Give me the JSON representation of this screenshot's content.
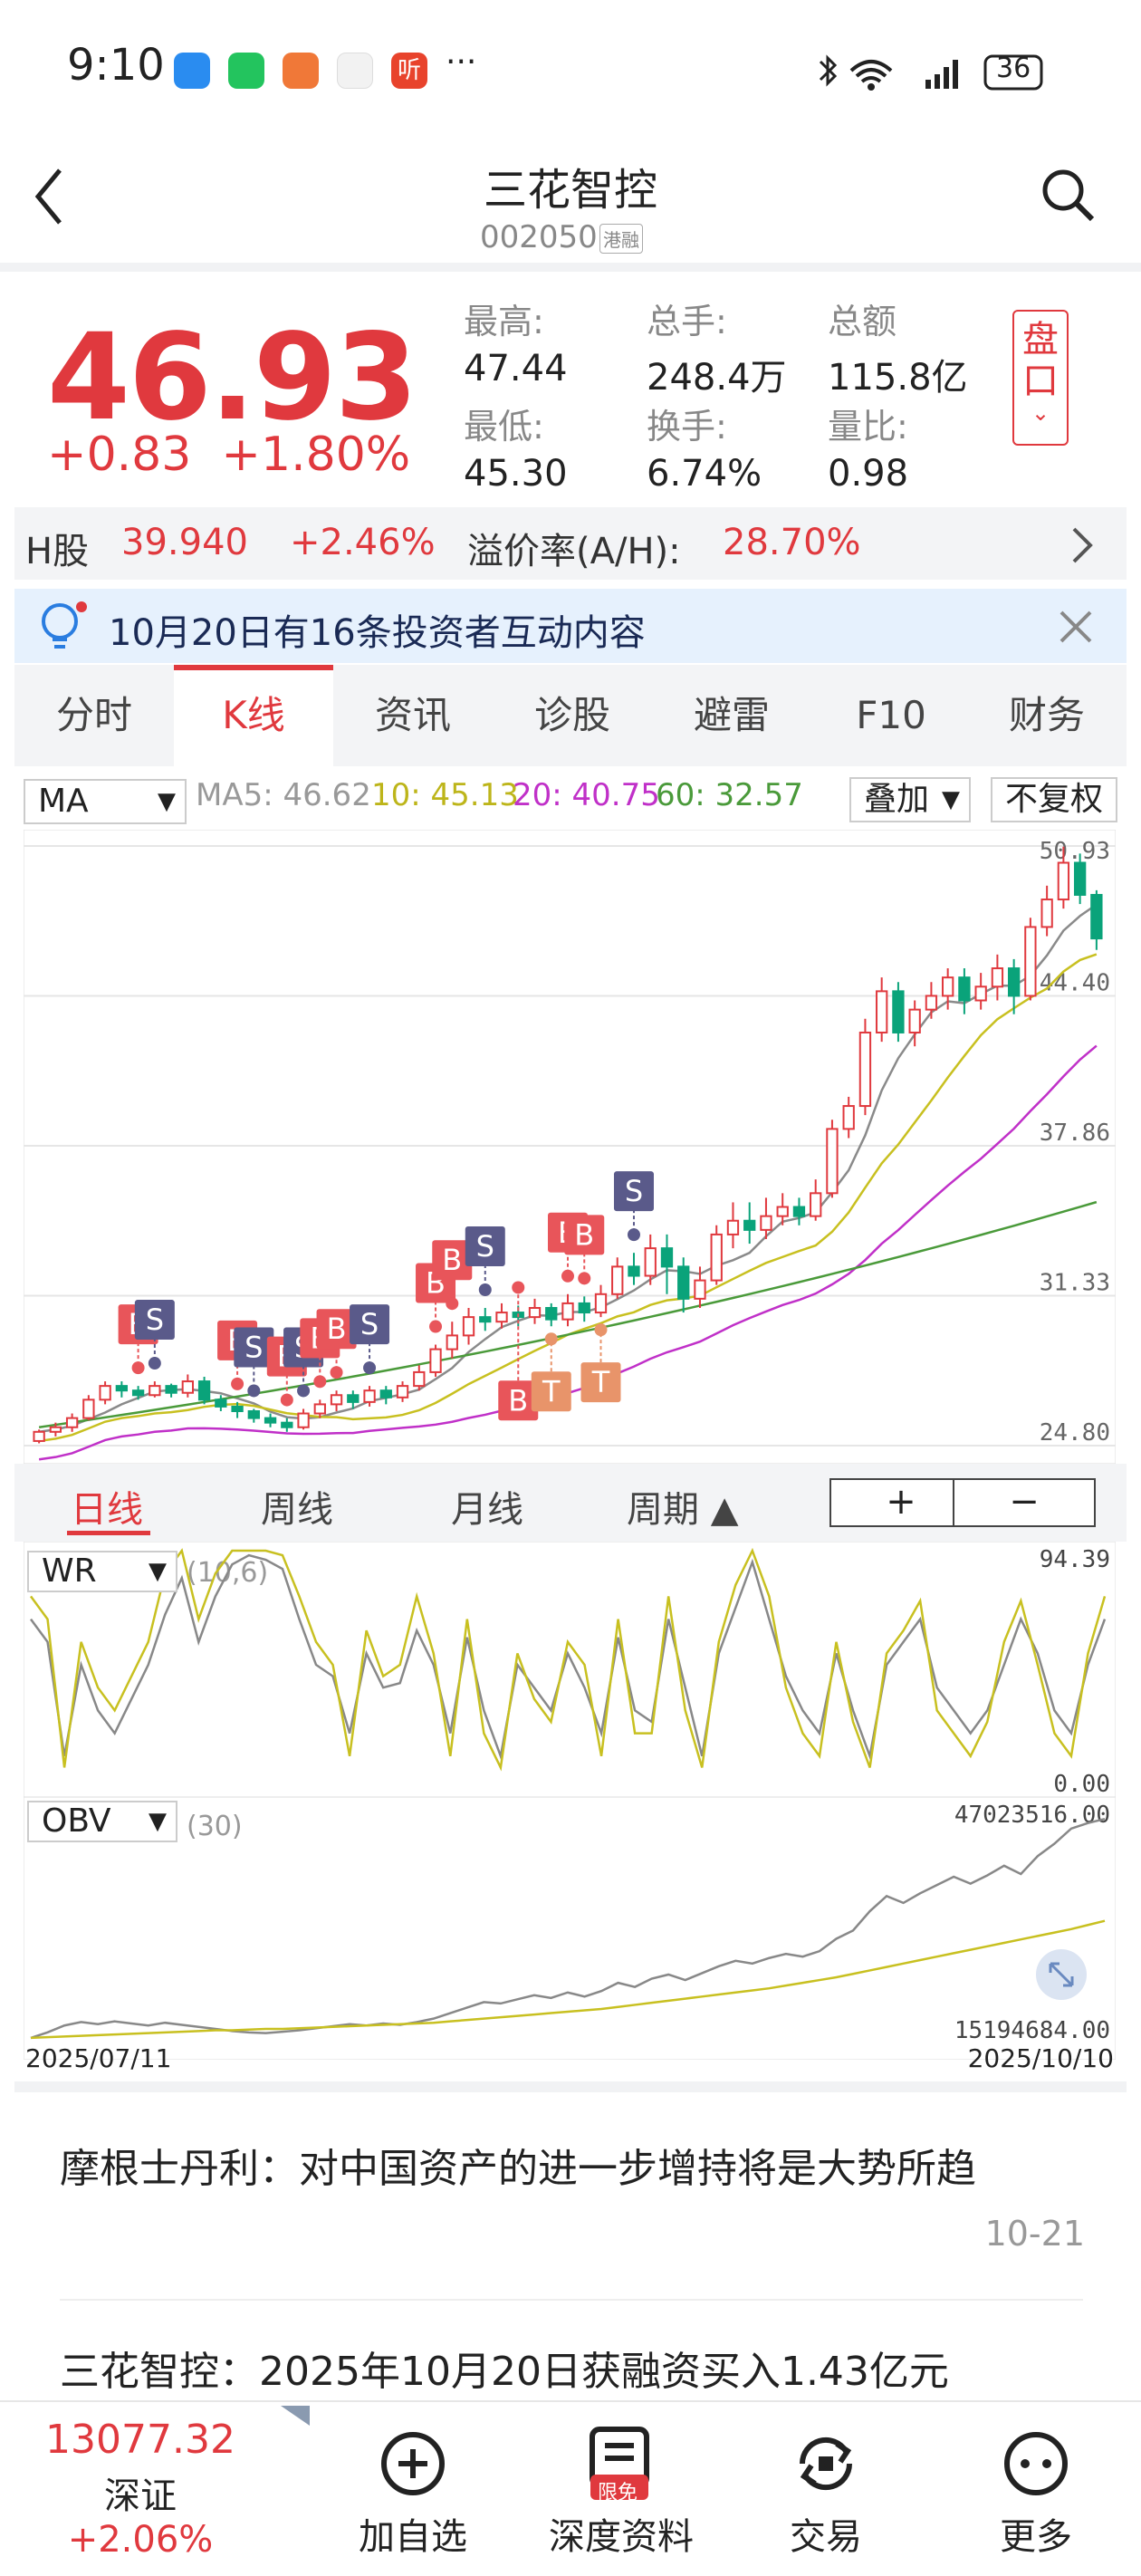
{
  "status_bar": {
    "time": "9:10",
    "more": "···",
    "battery": "36"
  },
  "header": {
    "title": "三花智控",
    "code": "002050",
    "badge": "港融"
  },
  "quote": {
    "price": "46.93",
    "change": "+0.83",
    "change_pct": "+1.80%",
    "high_label": "最高:",
    "high": "47.44",
    "low_label": "最低:",
    "low": "45.30",
    "volume_label": "总手:",
    "volume": "248.4万",
    "turnover_label": "换手:",
    "turnover": "6.74%",
    "amount_label": "总额",
    "amount": "115.8亿",
    "ratio_label": "量比:",
    "ratio": "0.98",
    "pankou": [
      "盘",
      "口"
    ]
  },
  "hshare": {
    "label": "H股",
    "price": "39.940",
    "pct": "+2.46%",
    "premium_label": "溢价率(A/H):",
    "premium": "28.70%"
  },
  "notice": {
    "text": "10月20日有16条投资者互动内容"
  },
  "tabs": [
    "分时",
    "K线",
    "资讯",
    "诊股",
    "避雷",
    "F10",
    "财务"
  ],
  "ma_row": {
    "selector": "MA",
    "ma5": "MA5: 46.62",
    "ma10": "10: 45.13",
    "ma20": "20: 40.75",
    "ma60": "60: 32.57",
    "overlay": "叠加",
    "adjust": "不复权"
  },
  "colors": {
    "up": "#e0393e",
    "down": "#0aa37a",
    "ma5": "#8a8a8a",
    "ma10": "#c8c020",
    "ma20": "#c030c8",
    "ma60": "#4a9a3a",
    "buy": "#e8555a",
    "sell": "#5a5a8a",
    "t": "#e8946a"
  },
  "chart_data": [
    {
      "type": "candlestick",
      "y_ticks": [
        "50.93",
        "44.40",
        "37.86",
        "31.33",
        "24.80"
      ],
      "ylim": [
        24.8,
        50.93
      ],
      "candles": [
        [
          25.0,
          25.4,
          24.9,
          25.5
        ],
        [
          25.4,
          25.6,
          25.2,
          25.8
        ],
        [
          25.6,
          26.0,
          25.4,
          26.2
        ],
        [
          26.0,
          26.8,
          25.9,
          27.0
        ],
        [
          26.8,
          27.4,
          26.6,
          27.6
        ],
        [
          27.4,
          27.2,
          26.9,
          27.6
        ],
        [
          27.2,
          27.0,
          26.8,
          27.4
        ],
        [
          27.0,
          27.4,
          26.9,
          27.6
        ],
        [
          27.4,
          27.1,
          26.9,
          27.5
        ],
        [
          27.1,
          27.6,
          26.9,
          27.9
        ],
        [
          27.6,
          26.8,
          26.6,
          27.8
        ],
        [
          26.8,
          26.5,
          26.3,
          27.0
        ],
        [
          26.5,
          26.3,
          26.0,
          26.7
        ],
        [
          26.3,
          26.0,
          25.8,
          26.4
        ],
        [
          26.0,
          25.8,
          25.6,
          26.2
        ],
        [
          25.8,
          25.6,
          25.4,
          26.0
        ],
        [
          25.6,
          26.2,
          25.5,
          26.4
        ],
        [
          26.2,
          26.6,
          26.0,
          26.8
        ],
        [
          26.6,
          27.0,
          26.3,
          27.2
        ],
        [
          27.0,
          26.7,
          26.4,
          27.2
        ],
        [
          26.7,
          27.2,
          26.5,
          27.4
        ],
        [
          27.2,
          26.9,
          26.6,
          27.4
        ],
        [
          26.9,
          27.4,
          26.7,
          27.6
        ],
        [
          27.4,
          28.0,
          27.2,
          28.3
        ],
        [
          28.0,
          29.0,
          27.8,
          29.2
        ],
        [
          29.0,
          29.6,
          28.6,
          30.2
        ],
        [
          29.6,
          30.4,
          29.2,
          30.8
        ],
        [
          30.4,
          30.2,
          29.8,
          30.8
        ],
        [
          30.2,
          30.6,
          29.9,
          31.0
        ],
        [
          30.6,
          30.4,
          30.0,
          30.9
        ],
        [
          30.4,
          30.8,
          30.1,
          31.2
        ],
        [
          30.8,
          30.3,
          30.0,
          31.0
        ],
        [
          30.3,
          31.0,
          30.0,
          31.4
        ],
        [
          31.0,
          30.6,
          30.2,
          31.3
        ],
        [
          30.6,
          31.4,
          30.4,
          31.8
        ],
        [
          31.4,
          32.6,
          31.2,
          33.0
        ],
        [
          32.6,
          32.2,
          31.8,
          33.2
        ],
        [
          32.2,
          33.4,
          31.8,
          34.0
        ],
        [
          33.4,
          32.6,
          31.4,
          34.0
        ],
        [
          32.6,
          31.2,
          30.6,
          33.0
        ],
        [
          31.2,
          32.0,
          30.8,
          32.6
        ],
        [
          32.0,
          34.0,
          31.8,
          34.4
        ],
        [
          34.0,
          34.6,
          33.4,
          35.4
        ],
        [
          34.6,
          34.2,
          33.6,
          35.4
        ],
        [
          34.2,
          34.8,
          33.8,
          35.6
        ],
        [
          34.8,
          35.2,
          34.4,
          35.8
        ],
        [
          35.2,
          34.8,
          34.4,
          35.6
        ],
        [
          34.8,
          35.8,
          34.6,
          36.4
        ],
        [
          35.8,
          38.6,
          35.6,
          39.0
        ],
        [
          38.6,
          39.6,
          38.2,
          40.0
        ],
        [
          39.6,
          42.8,
          39.2,
          43.4
        ],
        [
          42.8,
          44.6,
          42.4,
          45.2
        ],
        [
          44.6,
          42.8,
          42.4,
          45.0
        ],
        [
          42.8,
          43.8,
          42.2,
          44.2
        ],
        [
          43.8,
          44.4,
          43.4,
          45.0
        ],
        [
          44.4,
          45.2,
          43.8,
          45.6
        ],
        [
          45.2,
          44.2,
          43.6,
          45.6
        ],
        [
          44.2,
          44.8,
          43.8,
          45.4
        ],
        [
          44.8,
          45.6,
          44.2,
          46.2
        ],
        [
          45.6,
          44.4,
          43.6,
          46.0
        ],
        [
          44.4,
          47.4,
          44.2,
          47.8
        ],
        [
          47.4,
          48.6,
          47.0,
          49.2
        ],
        [
          48.6,
          50.2,
          48.2,
          50.9
        ],
        [
          50.2,
          48.8,
          48.4,
          50.6
        ],
        [
          48.8,
          46.9,
          46.4,
          49.0
        ]
      ],
      "signals": [
        {
          "type": "B",
          "label": "B",
          "index": 6
        },
        {
          "type": "S",
          "label": "S",
          "index": 7
        },
        {
          "type": "B",
          "label": "B",
          "index": 12
        },
        {
          "type": "S",
          "label": "S",
          "index": 13
        },
        {
          "type": "B",
          "label": "B",
          "index": 15
        },
        {
          "type": "S",
          "label": "S",
          "index": 16
        },
        {
          "type": "B",
          "label": "B",
          "index": 17
        },
        {
          "type": "B",
          "label": "B",
          "index": 18
        },
        {
          "type": "S",
          "label": "S",
          "index": 20
        },
        {
          "type": "B",
          "label": "B",
          "index": 24
        },
        {
          "type": "B",
          "label": "B",
          "index": 25
        },
        {
          "type": "S",
          "label": "S",
          "index": 27
        },
        {
          "type": "B",
          "label": "B",
          "index": 29
        },
        {
          "type": "T",
          "label": "T",
          "index": 31
        },
        {
          "type": "B",
          "label": "B",
          "index": 32
        },
        {
          "type": "B",
          "label": "B",
          "index": 33
        },
        {
          "type": "T",
          "label": "T",
          "index": 34
        },
        {
          "type": "S",
          "label": "S",
          "index": 36
        }
      ]
    },
    {
      "type": "line",
      "name": "WR",
      "params": "(10,6)",
      "y_ticks": [
        "94.39",
        "0.00"
      ],
      "ylim": [
        0,
        100
      ],
      "series": [
        {
          "values": [
            70,
            60,
            10,
            50,
            30,
            20,
            35,
            50,
            72,
            88,
            60,
            80,
            94,
            98,
            96,
            92,
            70,
            50,
            45,
            20,
            55,
            40,
            42,
            65,
            50,
            20,
            62,
            30,
            10,
            50,
            40,
            30,
            55,
            40,
            20,
            62,
            30,
            25,
            70,
            40,
            10,
            55,
            75,
            95,
            70,
            45,
            30,
            20,
            55,
            30,
            10,
            50,
            60,
            70,
            40,
            30,
            20,
            30,
            50,
            70,
            55,
            30,
            20,
            50,
            70
          ]
        },
        {
          "values": [
            80,
            70,
            5,
            60,
            40,
            30,
            45,
            60,
            90,
            100,
            70,
            90,
            100,
            100,
            100,
            98,
            80,
            60,
            50,
            10,
            65,
            45,
            50,
            80,
            55,
            10,
            70,
            20,
            5,
            55,
            35,
            25,
            60,
            50,
            10,
            70,
            20,
            20,
            80,
            30,
            5,
            60,
            85,
            100,
            80,
            40,
            20,
            10,
            60,
            25,
            5,
            55,
            65,
            78,
            30,
            20,
            10,
            25,
            60,
            78,
            50,
            20,
            10,
            55,
            80
          ]
        }
      ]
    },
    {
      "type": "line",
      "name": "OBV",
      "params": "(30)",
      "y_ticks": [
        "47023516.00",
        "15194684.00"
      ],
      "x_ticks": [
        "2025/07/11",
        "2025/10/10"
      ],
      "series": [
        {
          "values": [
            15.2,
            16.0,
            17.0,
            17.5,
            17.2,
            17.6,
            17.3,
            17.0,
            17.4,
            17.1,
            16.8,
            16.5,
            16.2,
            16.0,
            15.9,
            16.1,
            16.3,
            16.6,
            16.9,
            17.2,
            17.0,
            17.3,
            17.1,
            17.5,
            18.0,
            18.8,
            19.6,
            20.4,
            20.2,
            20.8,
            21.4,
            21.0,
            21.8,
            21.2,
            22.0,
            23.2,
            22.6,
            23.8,
            24.4,
            23.6,
            24.6,
            25.6,
            26.4,
            26.0,
            26.8,
            27.4,
            27.0,
            27.8,
            29.6,
            30.8,
            33.6,
            35.8,
            34.8,
            36.2,
            37.4,
            38.6,
            37.6,
            38.8,
            40.2,
            39.0,
            41.6,
            43.4,
            45.6,
            46.4,
            47.0
          ]
        },
        {
          "values": [
            15.2,
            15.3,
            15.4,
            15.5,
            15.6,
            15.7,
            15.8,
            15.9,
            16.0,
            16.1,
            16.2,
            16.3,
            16.3,
            16.4,
            16.5,
            16.5,
            16.6,
            16.7,
            16.8,
            16.9,
            17.0,
            17.1,
            17.2,
            17.3,
            17.4,
            17.6,
            17.8,
            18.0,
            18.2,
            18.4,
            18.6,
            18.8,
            19.0,
            19.2,
            19.4,
            19.7,
            20.0,
            20.3,
            20.6,
            20.9,
            21.2,
            21.5,
            21.8,
            22.1,
            22.4,
            22.8,
            23.2,
            23.6,
            24.0,
            24.5,
            25.0,
            25.5,
            26.0,
            26.5,
            27.0,
            27.5,
            28.0,
            28.5,
            29.0,
            29.5,
            30.0,
            30.5,
            31.0,
            31.6,
            32.2
          ]
        }
      ]
    }
  ],
  "period_row": {
    "items": [
      "日线",
      "周线",
      "月线",
      "周期 ▲"
    ],
    "zoom_in": "+",
    "zoom_out": "−"
  },
  "wr_selector": "WR",
  "obv_selector": "OBV",
  "news": [
    {
      "title": "摩根士丹利：对中国资产的进一步增持将是大势所趋",
      "time": "10-21"
    },
    {
      "title": "三花智控：2025年10月20日获融资买入1.43亿元",
      "time": ""
    }
  ],
  "bottom_nav": {
    "index_value": "13077.32",
    "index_name": "深证",
    "index_pct": "+2.06%",
    "items": [
      "加自选",
      "深度资料",
      "交易",
      "更多"
    ],
    "badge": "限免"
  }
}
